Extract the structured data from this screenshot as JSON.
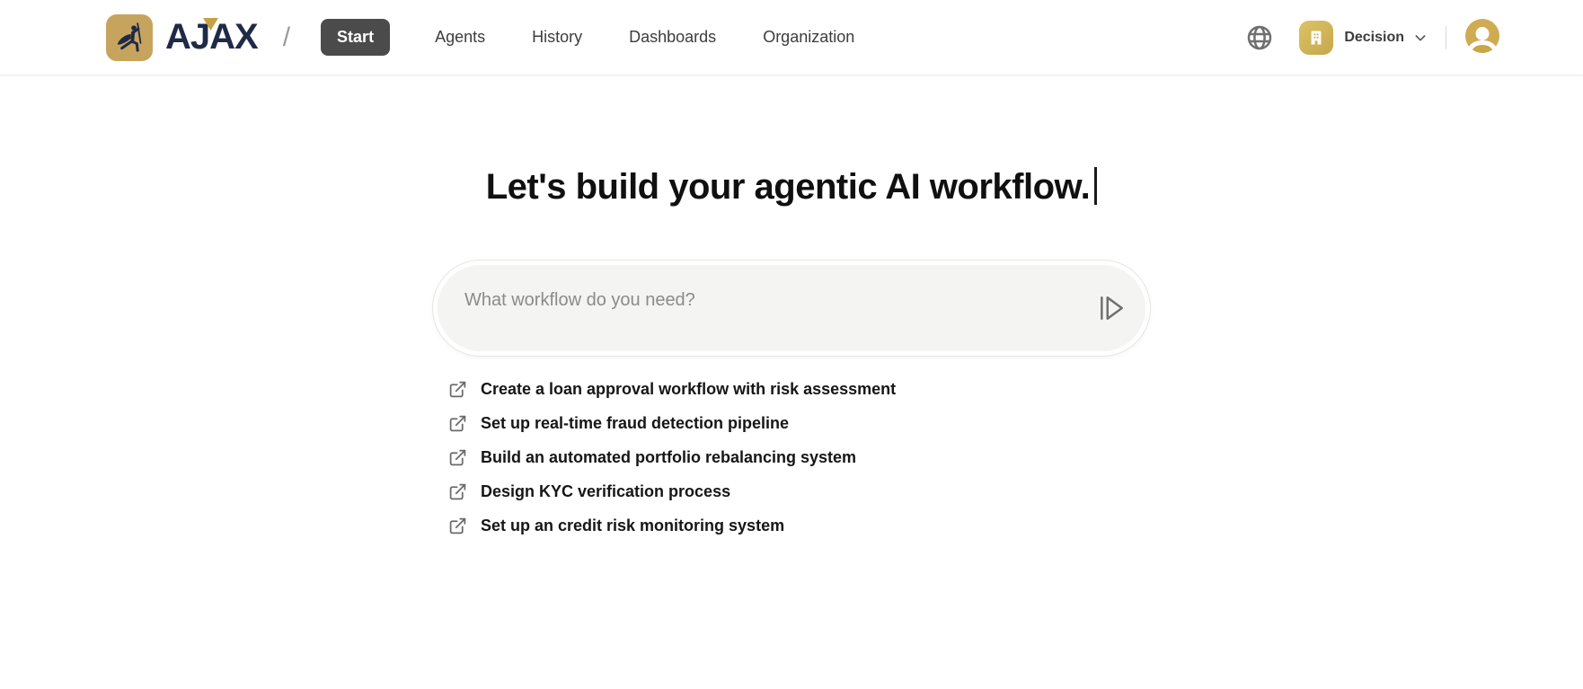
{
  "brand": {
    "name": "AJAX",
    "logo_icon": "spear-thrower-icon",
    "separator": "/"
  },
  "nav": {
    "items": [
      {
        "label": "Start",
        "active": true
      },
      {
        "label": "Agents",
        "active": false
      },
      {
        "label": "History",
        "active": false
      },
      {
        "label": "Dashboards",
        "active": false
      },
      {
        "label": "Organization",
        "active": false
      }
    ]
  },
  "topbar_right": {
    "language_icon": "globe-icon",
    "org_selector": {
      "icon": "building-icon",
      "label": "Decision",
      "chevron_icon": "chevron-down-icon"
    },
    "avatar_icon": "user-avatar-icon"
  },
  "hero": {
    "title": "Let's build your agentic AI workflow."
  },
  "composer": {
    "placeholder": "What workflow do you need?",
    "value": "",
    "submit_icon": "play-submit-icon"
  },
  "suggestions": {
    "item_icon": "external-link-icon",
    "items": [
      {
        "text": "Create a loan approval workflow with risk assessment"
      },
      {
        "text": "Set up real-time fraud detection pipeline"
      },
      {
        "text": "Build an automated portfolio rebalancing system"
      },
      {
        "text": "Design KYC verification process"
      },
      {
        "text": "Set up an credit risk monitoring system"
      }
    ]
  },
  "colors": {
    "brand_navy": "#1f2a47",
    "brand_gold": "#c7a45e",
    "nav_active_bg": "#4b4b4b",
    "heading_text": "#101010",
    "muted_icon": "#6f6f6f",
    "input_bg": "#f4f4f3",
    "border": "#e6e6e6"
  }
}
